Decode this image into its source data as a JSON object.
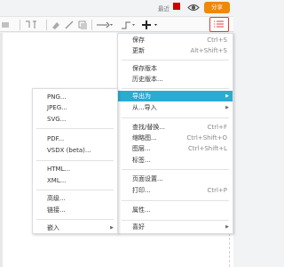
{
  "topbar": {
    "recent_label": "最近",
    "share_label": "分享"
  },
  "toolbar": {
    "icons": [
      "align-icon",
      "format-icon",
      "fill-color-icon",
      "line-color-icon",
      "shadow-icon",
      "connection-icon",
      "waypoints-icon",
      "insert-icon"
    ]
  },
  "main_menu": {
    "items": [
      {
        "label": "保存",
        "shortcut": "Ctrl+S"
      },
      {
        "label": "更新",
        "shortcut": "Alt+Shift+S"
      },
      {
        "label": "保存版本",
        "shortcut": ""
      },
      {
        "label": "历史版本...",
        "shortcut": ""
      },
      {
        "label": "导出为",
        "shortcut": ""
      },
      {
        "label": "从...导入",
        "shortcut": ""
      },
      {
        "label": "查找/替换...",
        "shortcut": "Ctrl+F"
      },
      {
        "label": "缩略图...",
        "shortcut": "Ctrl+Shift+O"
      },
      {
        "label": "图层...",
        "shortcut": "Ctrl+Shift+L"
      },
      {
        "label": "标签...",
        "shortcut": ""
      },
      {
        "label": "页面设置...",
        "shortcut": ""
      },
      {
        "label": "打印...",
        "shortcut": "Ctrl+P"
      },
      {
        "label": "属性...",
        "shortcut": ""
      },
      {
        "label": "喜好",
        "shortcut": ""
      }
    ]
  },
  "export_submenu": {
    "items": [
      "PNG...",
      "JPEG...",
      "SVG...",
      "PDF...",
      "VSDX (beta)...",
      "HTML...",
      "XML...",
      "高级...",
      "链接...",
      "嵌入"
    ]
  },
  "colors": {
    "share": "#f08705",
    "highlight": "#2aabd2",
    "format_button_border": "#e53935"
  }
}
